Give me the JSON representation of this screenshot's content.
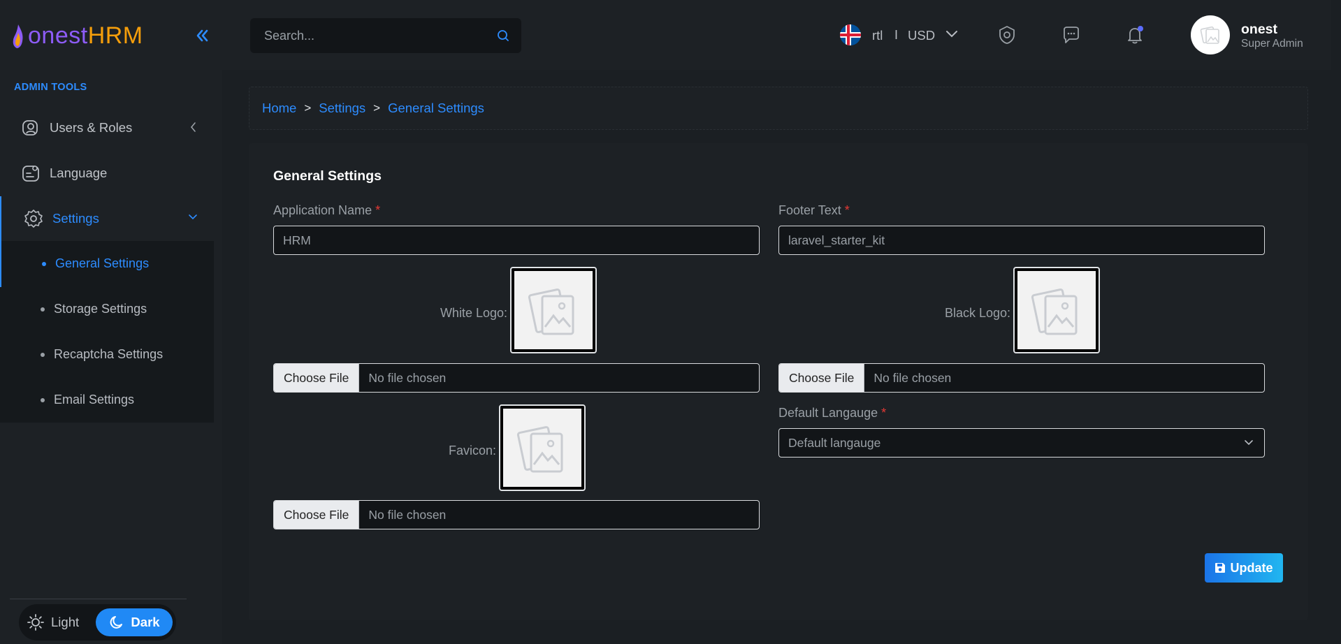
{
  "brand": {
    "part1": "onest",
    "part2": "HRM"
  },
  "sidebar": {
    "section_title": "ADMIN TOOLS",
    "items": [
      {
        "label": "Users & Roles",
        "icon": "users-icon"
      },
      {
        "label": "Language",
        "icon": "language-icon"
      },
      {
        "label": "Settings",
        "icon": "gear-icon"
      }
    ],
    "submenu": [
      {
        "label": "General Settings"
      },
      {
        "label": "Storage Settings"
      },
      {
        "label": "Recaptcha Settings"
      },
      {
        "label": "Email Settings"
      }
    ],
    "theme": {
      "light_label": "Light",
      "dark_label": "Dark"
    }
  },
  "header": {
    "search_placeholder": "Search...",
    "direction": "rtl",
    "separator": "I",
    "currency": "USD",
    "user": {
      "name": "onest",
      "role": "Super Admin"
    }
  },
  "breadcrumb": {
    "items": [
      "Home",
      "Settings",
      "General Settings"
    ],
    "separator": ">"
  },
  "form": {
    "title": "General Settings",
    "required_mark": "*",
    "app_name": {
      "label": "Application Name",
      "placeholder": "HRM"
    },
    "footer_text": {
      "label": "Footer Text",
      "placeholder": "laravel_starter_kit"
    },
    "white_logo": {
      "label": "White Logo:"
    },
    "black_logo": {
      "label": "Black Logo:"
    },
    "favicon": {
      "label": "Favicon:"
    },
    "file": {
      "button": "Choose File",
      "status": "No file chosen"
    },
    "default_language": {
      "label": "Default Langauge",
      "placeholder": "Default langauge"
    },
    "update_label": "Update"
  },
  "colors": {
    "accent": "#2d8cff",
    "background": "#1b1f23",
    "card": "#1d2125",
    "required": "#e53935"
  }
}
